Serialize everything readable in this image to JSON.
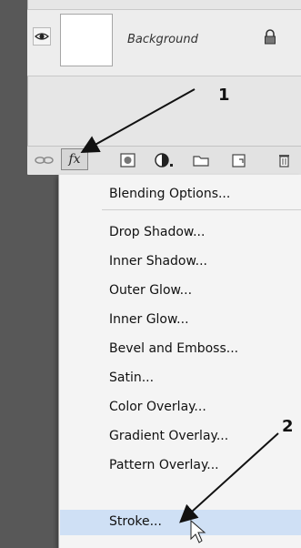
{
  "layers": {
    "layer_name": "Background"
  },
  "toolbar": {
    "fx_label": "fx",
    "buttons": [
      "link-icon",
      "fx-button",
      "mask-icon",
      "adjustment-icon",
      "folder-icon",
      "new-layer-icon",
      "trash-icon"
    ]
  },
  "menu": {
    "items": [
      "Blending Options...",
      "Drop Shadow...",
      "Inner Shadow...",
      "Outer Glow...",
      "Inner Glow...",
      "Bevel and Emboss...",
      "Satin...",
      "Color Overlay...",
      "Gradient Overlay...",
      "Pattern Overlay...",
      "Stroke..."
    ],
    "highlighted": "Stroke..."
  },
  "annotations": {
    "step1": "1",
    "step2": "2"
  },
  "colors": {
    "background": "#585858",
    "panel": "#e6e6e6",
    "menu": "#f4f4f4",
    "highlight": "#cfe0f5"
  }
}
